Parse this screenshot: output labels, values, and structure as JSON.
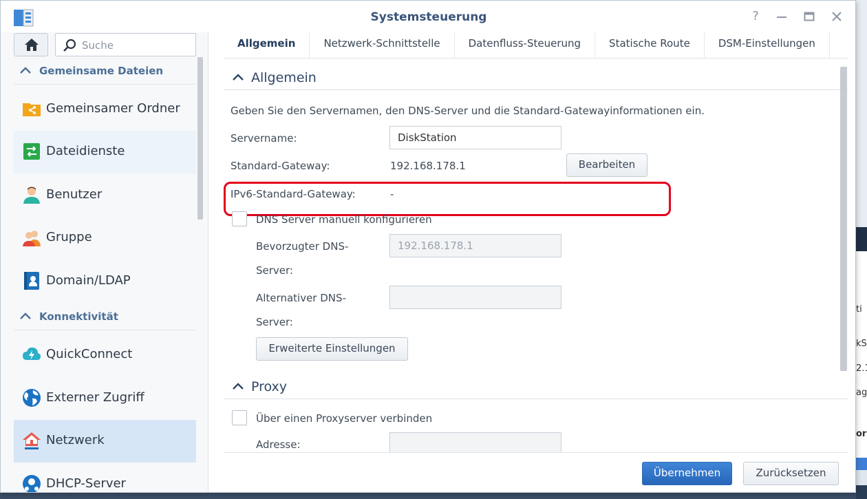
{
  "window": {
    "title": "Systemsteuerung"
  },
  "sidebar": {
    "search_placeholder": "Suche",
    "sections": [
      {
        "label": "Gemeinsame Dateien"
      },
      {
        "label": "Konnektivität"
      }
    ],
    "items": [
      {
        "label": "Gemeinsamer Ordner"
      },
      {
        "label": "Dateidienste"
      },
      {
        "label": "Benutzer"
      },
      {
        "label": "Gruppe"
      },
      {
        "label": "Domain/LDAP"
      },
      {
        "label": "QuickConnect"
      },
      {
        "label": "Externer Zugriff"
      },
      {
        "label": "Netzwerk"
      },
      {
        "label": "DHCP-Server"
      }
    ]
  },
  "tabs": [
    {
      "label": "Allgemein"
    },
    {
      "label": "Netzwerk-Schnittstelle"
    },
    {
      "label": "Datenfluss-Steuerung"
    },
    {
      "label": "Statische Route"
    },
    {
      "label": "DSM-Einstellungen"
    }
  ],
  "general": {
    "header": "Allgemein",
    "description": "Geben Sie den Servernamen, den DNS-Server und die Standard-Gatewayinformationen ein.",
    "servername_label": "Servername:",
    "servername_value": "DiskStation",
    "gateway_label": "Standard-Gateway:",
    "gateway_value": "192.168.178.1",
    "edit_button": "Bearbeiten",
    "ipv6_label": "IPv6-Standard-Gateway:",
    "ipv6_value": "-",
    "dns_manual_label": "DNS Server manuell konfigurieren",
    "preferred_dns_label_1": "Bevorzugter DNS-",
    "preferred_dns_label_2": "Server:",
    "preferred_dns_value": "192.168.178.1",
    "alt_dns_label_1": "Alternativer DNS-",
    "alt_dns_label_2": "Server:",
    "alt_dns_value": "",
    "advanced_button": "Erweiterte Einstellungen"
  },
  "proxy": {
    "header": "Proxy",
    "connect_label": "Über einen Proxyserver verbinden",
    "address_label": "Adresse:",
    "address_value": ""
  },
  "footer": {
    "apply_button": "Übernehmen",
    "reset_button": "Zurücksetzen"
  },
  "background_fragments": [
    "ti",
    "kS",
    "2.1",
    "ag",
    "or"
  ]
}
